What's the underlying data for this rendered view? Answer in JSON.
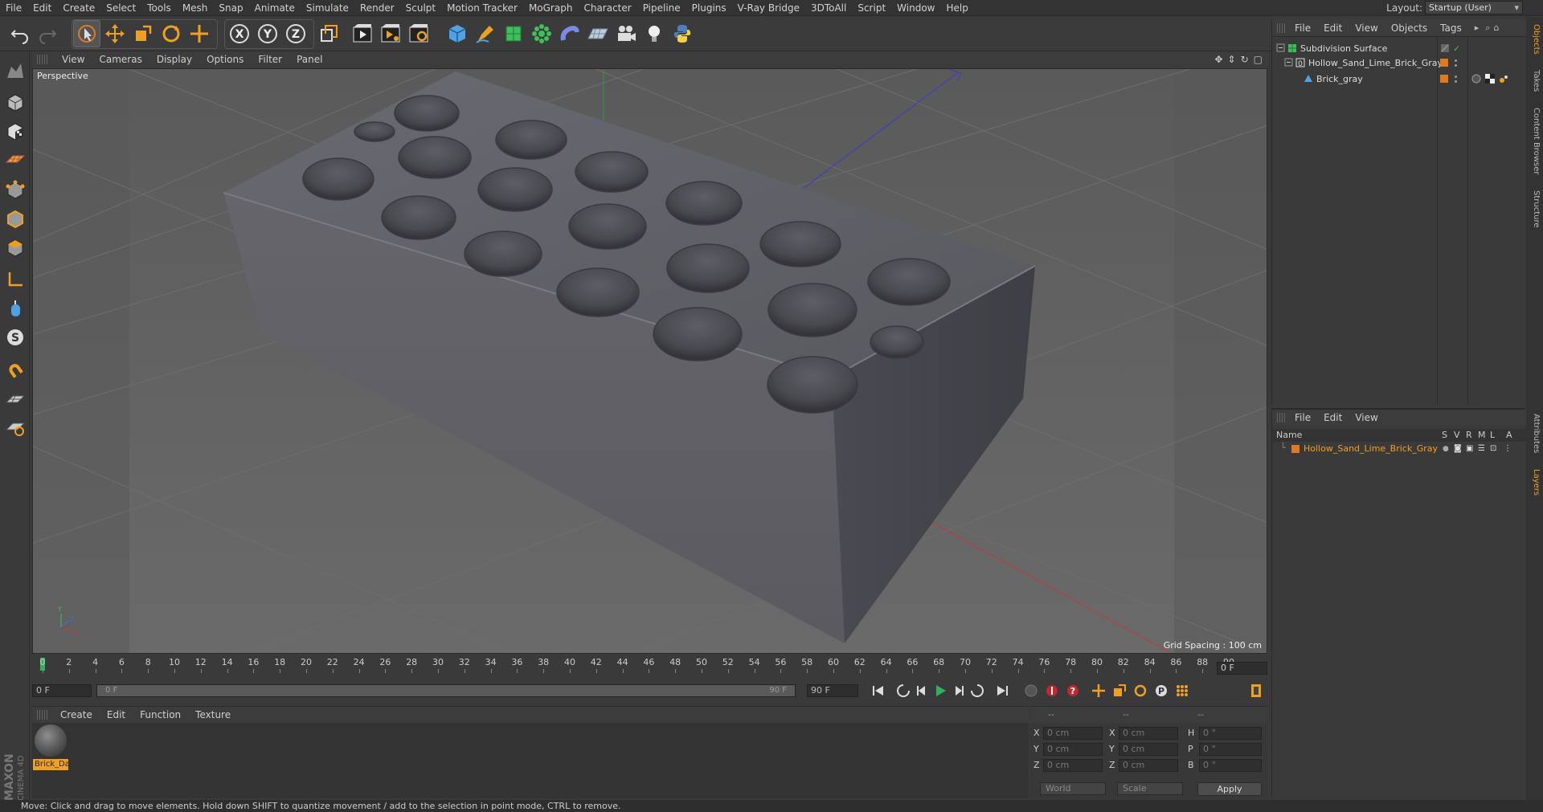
{
  "menubar": {
    "items": [
      "File",
      "Edit",
      "Create",
      "Select",
      "Tools",
      "Mesh",
      "Snap",
      "Animate",
      "Simulate",
      "Render",
      "Sculpt",
      "Motion Tracker",
      "MoGraph",
      "Character",
      "Pipeline",
      "Plugins",
      "V-Ray Bridge",
      "3DToAll",
      "Script",
      "Window",
      "Help"
    ],
    "layout_label": "Layout:",
    "layout_value": "Startup (User)"
  },
  "toolbar": {
    "icons": [
      "undo-icon",
      "redo-icon",
      "live-selection-icon",
      "move-icon",
      "scale-icon",
      "rotate-icon",
      "recent-tool-icon",
      "x-axis-icon",
      "y-axis-icon",
      "z-axis-icon",
      "coordinate-system-icon",
      "render-view-icon",
      "render-picture-viewer-icon",
      "render-settings-icon",
      "cube-icon",
      "pen-icon",
      "subdivision-icon",
      "array-icon",
      "deformer-icon",
      "floor-icon",
      "camera-icon",
      "light-icon",
      "python-icon"
    ],
    "axis_labels": [
      "X",
      "Y",
      "Z"
    ]
  },
  "viewport": {
    "menu": [
      "View",
      "Cameras",
      "Display",
      "Options",
      "Filter",
      "Panel"
    ],
    "label": "Perspective",
    "grid_spacing": "Grid Spacing : 100 cm"
  },
  "timeline": {
    "ticks": [
      "0",
      "2",
      "4",
      "6",
      "8",
      "10",
      "12",
      "14",
      "16",
      "18",
      "20",
      "22",
      "24",
      "26",
      "28",
      "30",
      "32",
      "34",
      "36",
      "38",
      "40",
      "42",
      "44",
      "46",
      "48",
      "50",
      "52",
      "54",
      "56",
      "58",
      "60",
      "62",
      "64",
      "66",
      "68",
      "70",
      "72",
      "74",
      "76",
      "78",
      "80",
      "82",
      "84",
      "86",
      "88",
      "90"
    ],
    "current_frame_field": "0 F",
    "start_field": "0 F",
    "range_start": "0 F",
    "range_end": "90 F",
    "end_field": "90 F"
  },
  "material_manager": {
    "menu": [
      "Create",
      "Edit",
      "Function",
      "Texture"
    ],
    "material_name": "Brick_Da"
  },
  "coordinates": {
    "head_left": "--",
    "head_mid": "--",
    "head_right": "--",
    "rows": [
      {
        "l1": "X",
        "v1": "0 cm",
        "l2": "X",
        "v2": "0 cm",
        "l3": "H",
        "v3": "0 °"
      },
      {
        "l1": "Y",
        "v1": "0 cm",
        "l2": "Y",
        "v2": "0 cm",
        "l3": "P",
        "v3": "0 °"
      },
      {
        "l1": "Z",
        "v1": "0 cm",
        "l2": "Z",
        "v2": "0 cm",
        "l3": "B",
        "v3": "0 °"
      }
    ],
    "world_dropdown": "World",
    "scale_dropdown": "Scale",
    "apply_label": "Apply"
  },
  "object_manager": {
    "menu": [
      "File",
      "Edit",
      "View",
      "Objects",
      "Tags"
    ],
    "objects": [
      {
        "name": "Subdivision Surface",
        "indent": 0
      },
      {
        "name": "Hollow_Sand_Lime_Brick_Gray",
        "indent": 1
      },
      {
        "name": "Brick_gray",
        "indent": 2
      }
    ]
  },
  "layer_manager": {
    "menu": [
      "File",
      "Edit",
      "View"
    ],
    "columns": [
      "Name",
      "S",
      "V",
      "R",
      "M",
      "L",
      "A"
    ],
    "layer_name": "Hollow_Sand_Lime_Brick_Gray"
  },
  "right_tabs": [
    "Objects",
    "Takes",
    "Content Browser",
    "Structure",
    "Attributes",
    "Layers"
  ],
  "status": "Move: Click and drag to move elements. Hold down SHIFT to quantize movement / add to the selection in point mode, CTRL to remove.",
  "brand": {
    "line1": "MAXON",
    "line2": "CINEMA 4D"
  },
  "colors": {
    "accent": "#f0a020",
    "playhead": "#2fb35a",
    "viewport_bg": "#5f5f5f"
  }
}
